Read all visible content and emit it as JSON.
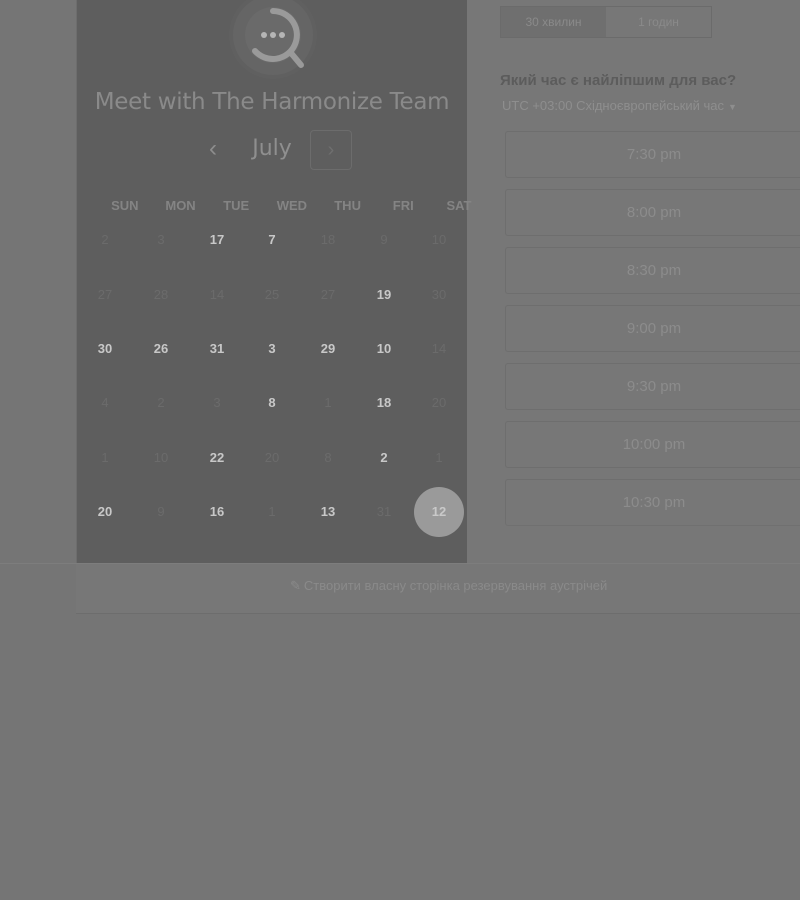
{
  "header": {
    "team_title": "Meet with The Harmonize Team",
    "logo_icon": "chat-bubble-icon"
  },
  "calendar": {
    "month": "July",
    "prev_icon": "chevron-left-icon",
    "next_icon": "chevron-right-icon",
    "weekdays": [
      "SUN",
      "MON",
      "TUE",
      "WED",
      "THU",
      "FRI",
      "SAT"
    ],
    "rows": [
      [
        {
          "label": "2",
          "available": false
        },
        {
          "label": "3",
          "available": false
        },
        {
          "label": "17",
          "available": true
        },
        {
          "label": "7",
          "available": true
        },
        {
          "label": "18",
          "available": false
        },
        {
          "label": "9",
          "available": false
        },
        {
          "label": "10",
          "available": false
        }
      ],
      [
        {
          "label": "27",
          "available": false
        },
        {
          "label": "28",
          "available": false
        },
        {
          "label": "14",
          "available": false
        },
        {
          "label": "25",
          "available": false
        },
        {
          "label": "27",
          "available": false
        },
        {
          "label": "19",
          "available": true
        },
        {
          "label": "30",
          "available": false
        }
      ],
      [
        {
          "label": "30",
          "available": true
        },
        {
          "label": "26",
          "available": true
        },
        {
          "label": "31",
          "available": true
        },
        {
          "label": "3",
          "available": true
        },
        {
          "label": "29",
          "available": true
        },
        {
          "label": "10",
          "available": true
        },
        {
          "label": "14",
          "available": false
        }
      ],
      [
        {
          "label": "4",
          "available": false
        },
        {
          "label": "2",
          "available": false
        },
        {
          "label": "3",
          "available": false
        },
        {
          "label": "8",
          "available": true
        },
        {
          "label": "1",
          "available": false
        },
        {
          "label": "18",
          "available": true
        },
        {
          "label": "20",
          "available": false
        }
      ],
      [
        {
          "label": "1",
          "available": false
        },
        {
          "label": "10",
          "available": false
        },
        {
          "label": "22",
          "available": true
        },
        {
          "label": "20",
          "available": false
        },
        {
          "label": "8",
          "available": false
        },
        {
          "label": "2",
          "available": true
        },
        {
          "label": "1",
          "available": false
        }
      ],
      [
        {
          "label": "20",
          "available": true
        },
        {
          "label": "9",
          "available": false
        },
        {
          "label": "16",
          "available": true
        },
        {
          "label": "1",
          "available": false
        },
        {
          "label": "13",
          "available": true
        },
        {
          "label": "31",
          "available": false
        },
        {
          "label": "12",
          "available": true,
          "selected": true
        }
      ]
    ]
  },
  "durations": {
    "tabs": [
      {
        "label": "30 хвилин",
        "active": true
      },
      {
        "label": "1 годин",
        "active": false
      }
    ]
  },
  "scheduler": {
    "question": "Який час є найліпшим для вас?",
    "timezone": "UTC +03:00 Східноєвропейський час",
    "timezone_icon": "caret-down-icon",
    "slots": [
      "7:30 pm",
      "8:00 pm",
      "8:30 pm",
      "9:00 pm",
      "9:30 pm",
      "10:00 pm",
      "10:30 pm"
    ]
  },
  "footer": {
    "icon": "magic-wand-icon",
    "link_text": "Створити власну сторінка резервування аустрічей"
  },
  "colors": {
    "overlay": "#757575",
    "left_panel": "#5e5e5e",
    "selected_day": "#9a9a9a"
  }
}
